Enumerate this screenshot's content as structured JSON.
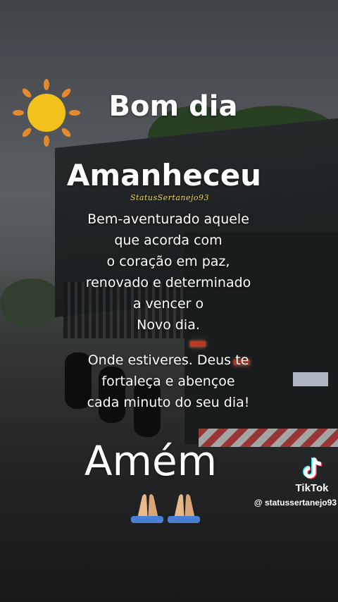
{
  "greeting": "Bom dia",
  "heading": "Amanheceu",
  "watermark": "StatusSertanejo93",
  "message": {
    "lines_1": [
      "Bem-aventurado aquele",
      "que acorda com",
      "o coração em paz,",
      "renovado e determinado",
      "a vencer o",
      "Novo dia."
    ],
    "lines_2": [
      "Onde estiveres. Deus te",
      "fortaleça e abençoe",
      "cada minuto do seu dia!"
    ]
  },
  "closing": "Amém",
  "emoji": "folded-hands x2",
  "tiktok": {
    "brand": "TikTok",
    "username": "@ statussertanejo93"
  },
  "colors": {
    "sun": "#f2c21a",
    "sun_rays": "#e58a2c",
    "text": "#ffffff",
    "watermark": "#e8d85a"
  }
}
